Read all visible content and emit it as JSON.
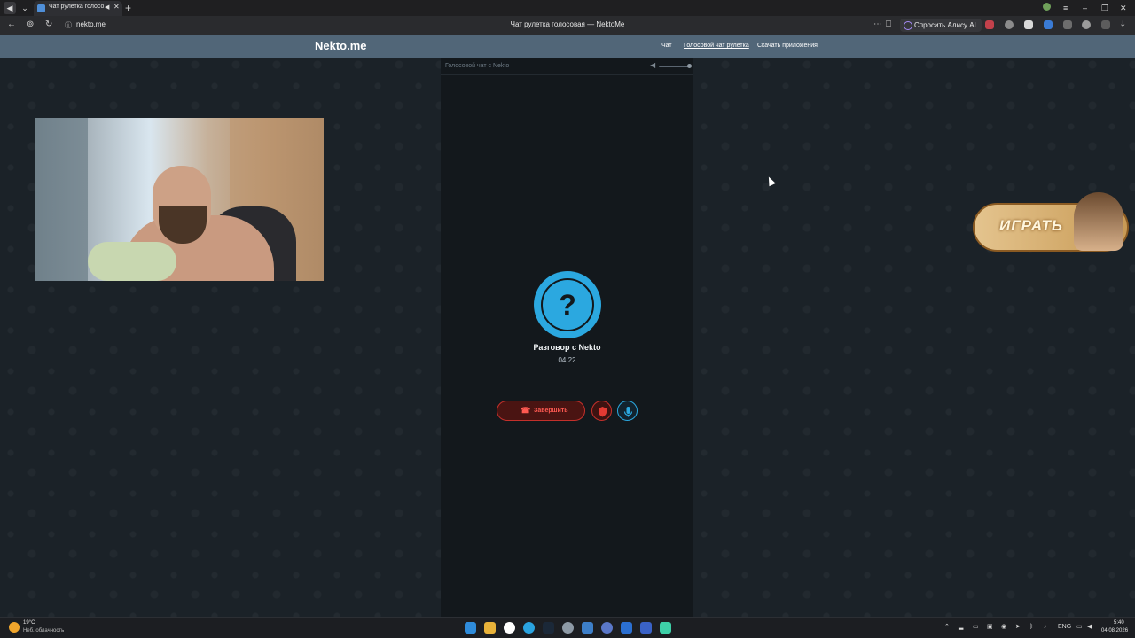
{
  "browser": {
    "tab_title": "Чат рулетка голосов",
    "url": "nekto.me",
    "page_title": "Чат рулетка голосовая — NektoMe",
    "alice_label": "Спросить Алису AI"
  },
  "site": {
    "logo": "Nekto.me",
    "nav": [
      {
        "label": "Чат",
        "active": false
      },
      {
        "label": "Голосовой чат рулетка",
        "active": true
      },
      {
        "label": "Скачать приложения",
        "active": false
      }
    ]
  },
  "call": {
    "panel_title": "Голосовой чат с Nekto",
    "avatar_symbol": "?",
    "title": "Разговор с Nekto",
    "timer": "04:22",
    "end_label": "Завершить"
  },
  "promo": {
    "label": "ИГРАТЬ"
  },
  "taskbar": {
    "weather_temp": "19°C",
    "weather_desc": "Неб. облачность",
    "lang": "ENG",
    "time": "5:40",
    "date": "04.08.2026"
  },
  "colors": {
    "accent": "#2ba8e0",
    "danger": "#c4302b",
    "header": "#516678",
    "panel": "#13181c"
  }
}
